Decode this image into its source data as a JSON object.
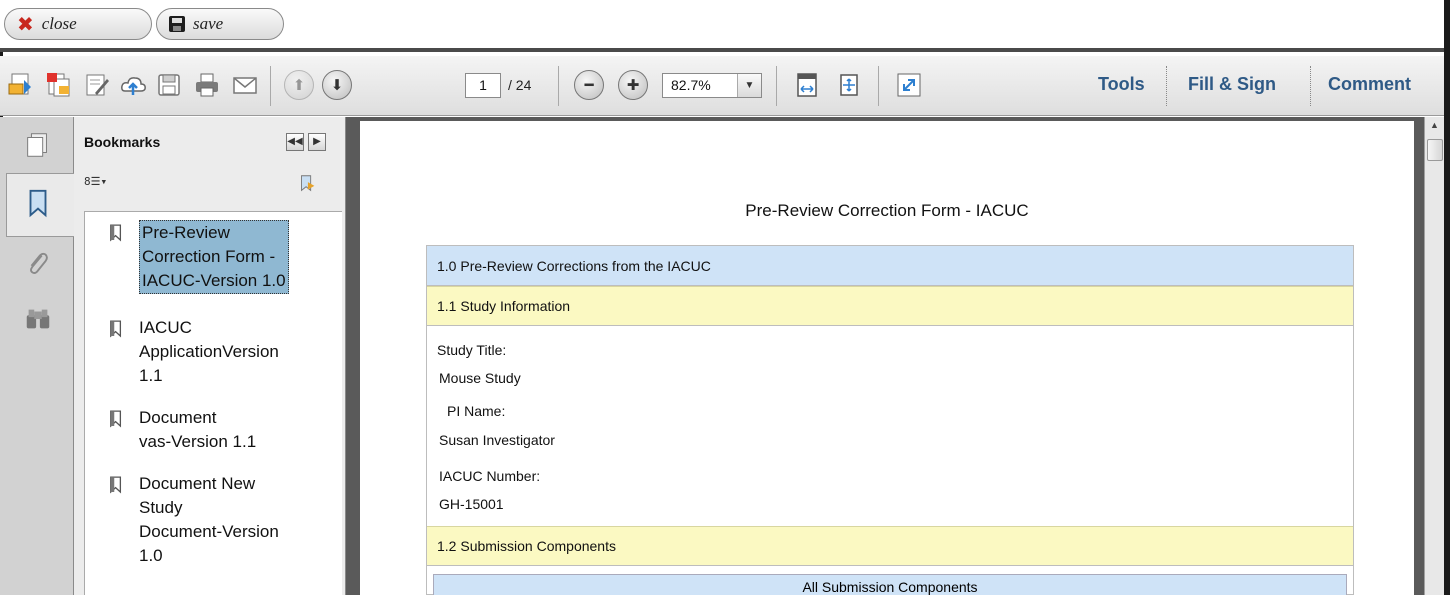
{
  "topbar": {
    "close_label": "close",
    "save_label": "save"
  },
  "toolbar": {
    "page_current": "1",
    "page_total": "/ 24",
    "zoom": "82.7%",
    "tools_label": "Tools",
    "fill_sign_label": "Fill & Sign",
    "comment_label": "Comment"
  },
  "bookmarks": {
    "title": "Bookmarks",
    "items": [
      {
        "label": "Pre-Review\nCorrection Form -\nIACUC-Version 1.0",
        "selected": true
      },
      {
        "label": "IACUC\nApplicationVersion\n1.1"
      },
      {
        "label": "Document\nvas-Version 1.1"
      },
      {
        "label": "Document New\nStudy\nDocument-Version\n1.0"
      }
    ]
  },
  "document": {
    "title": "Pre-Review Correction Form - IACUC",
    "section_1_0": "1.0 Pre-Review Corrections from the IACUC",
    "section_1_1": "1.1 Study Information",
    "study_title_label": "Study Title:",
    "study_title_value": "Mouse Study",
    "pi_name_label": "PI Name:",
    "pi_name_value": "Susan Investigator",
    "iacuc_number_label": "IACUC Number:",
    "iacuc_number_value": "GH-15001",
    "section_1_2": "1.2 Submission Components",
    "all_components_label": "All Submission Components"
  },
  "colors": {
    "link_blue": "#2f5a86",
    "section_blue": "#cfe3f7",
    "section_yellow": "#fbf9c2",
    "bookmark_selected": "#8fb8d2"
  }
}
